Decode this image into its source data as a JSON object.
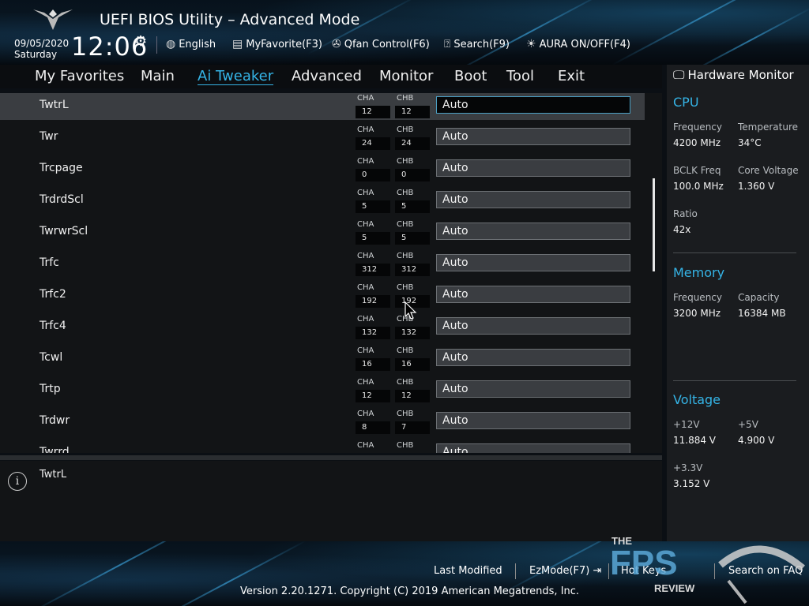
{
  "header": {
    "title": "UEFI BIOS Utility – Advanced Mode",
    "date": "09/05/2020",
    "weekday": "Saturday",
    "time": "12:06",
    "items": [
      {
        "label": "English",
        "icon": "globe-icon"
      },
      {
        "label": "MyFavorite(F3)",
        "icon": "favorite-icon"
      },
      {
        "label": "Qfan Control(F6)",
        "icon": "fan-icon"
      },
      {
        "label": "Search(F9)",
        "icon": "search-icon"
      },
      {
        "label": "AURA ON/OFF(F4)",
        "icon": "aura-icon"
      }
    ]
  },
  "nav": {
    "tabs": [
      "My Favorites",
      "Main",
      "Ai Tweaker",
      "Advanced",
      "Monitor",
      "Boot",
      "Tool",
      "Exit"
    ],
    "active": "Ai Tweaker"
  },
  "table": {
    "channel_a": "CHA",
    "channel_b": "CHB",
    "rows": [
      {
        "label": "TwtrL",
        "cha": "12",
        "chb": "12",
        "value": "Auto"
      },
      {
        "label": "Twr",
        "cha": "24",
        "chb": "24",
        "value": "Auto"
      },
      {
        "label": "Trcpage",
        "cha": "0",
        "chb": "0",
        "value": "Auto"
      },
      {
        "label": "TrdrdScl",
        "cha": "5",
        "chb": "5",
        "value": "Auto"
      },
      {
        "label": "TwrwrScl",
        "cha": "5",
        "chb": "5",
        "value": "Auto"
      },
      {
        "label": "Trfc",
        "cha": "312",
        "chb": "312",
        "value": "Auto"
      },
      {
        "label": "Trfc2",
        "cha": "192",
        "chb": "192",
        "value": "Auto"
      },
      {
        "label": "Trfc4",
        "cha": "132",
        "chb": "132",
        "value": "Auto"
      },
      {
        "label": "Tcwl",
        "cha": "16",
        "chb": "16",
        "value": "Auto"
      },
      {
        "label": "Trtp",
        "cha": "12",
        "chb": "12",
        "value": "Auto"
      },
      {
        "label": "Trdwr",
        "cha": "8",
        "chb": "7",
        "value": "Auto"
      },
      {
        "label": "Twrrd",
        "cha": "",
        "chb": "",
        "value": "Auto"
      }
    ]
  },
  "help": {
    "text": "TwtrL"
  },
  "monitor": {
    "title": "Hardware Monitor",
    "cpu": {
      "title": "CPU",
      "frequency_label": "Frequency",
      "frequency": "4200 MHz",
      "temperature_label": "Temperature",
      "temperature": "34°C",
      "bclk_label": "BCLK Freq",
      "bclk": "100.0 MHz",
      "core_voltage_label": "Core Voltage",
      "core_voltage": "1.360 V",
      "ratio_label": "Ratio",
      "ratio": "42x"
    },
    "memory": {
      "title": "Memory",
      "frequency_label": "Frequency",
      "frequency": "3200 MHz",
      "capacity_label": "Capacity",
      "capacity": "16384 MB"
    },
    "voltage": {
      "title": "Voltage",
      "v12_label": "+12V",
      "v12": "11.884 V",
      "v5_label": "+5V",
      "v5": "4.900 V",
      "v33_label": "+3.3V",
      "v33": "3.152 V"
    }
  },
  "footer": {
    "last_modified": "Last Modified",
    "ezmode": "EzMode(F7)",
    "hot_keys": "Hot Keys",
    "search_faq": "Search on FAQ",
    "version": "Version 2.20.1271. Copyright (C) 2019 American Megatrends, Inc."
  },
  "watermark": {
    "line1": "THE",
    "line2": "FPS",
    "line3": "REVIEW"
  },
  "colors": {
    "accent": "#35b4e6",
    "selected_row": "#3a3d41"
  }
}
